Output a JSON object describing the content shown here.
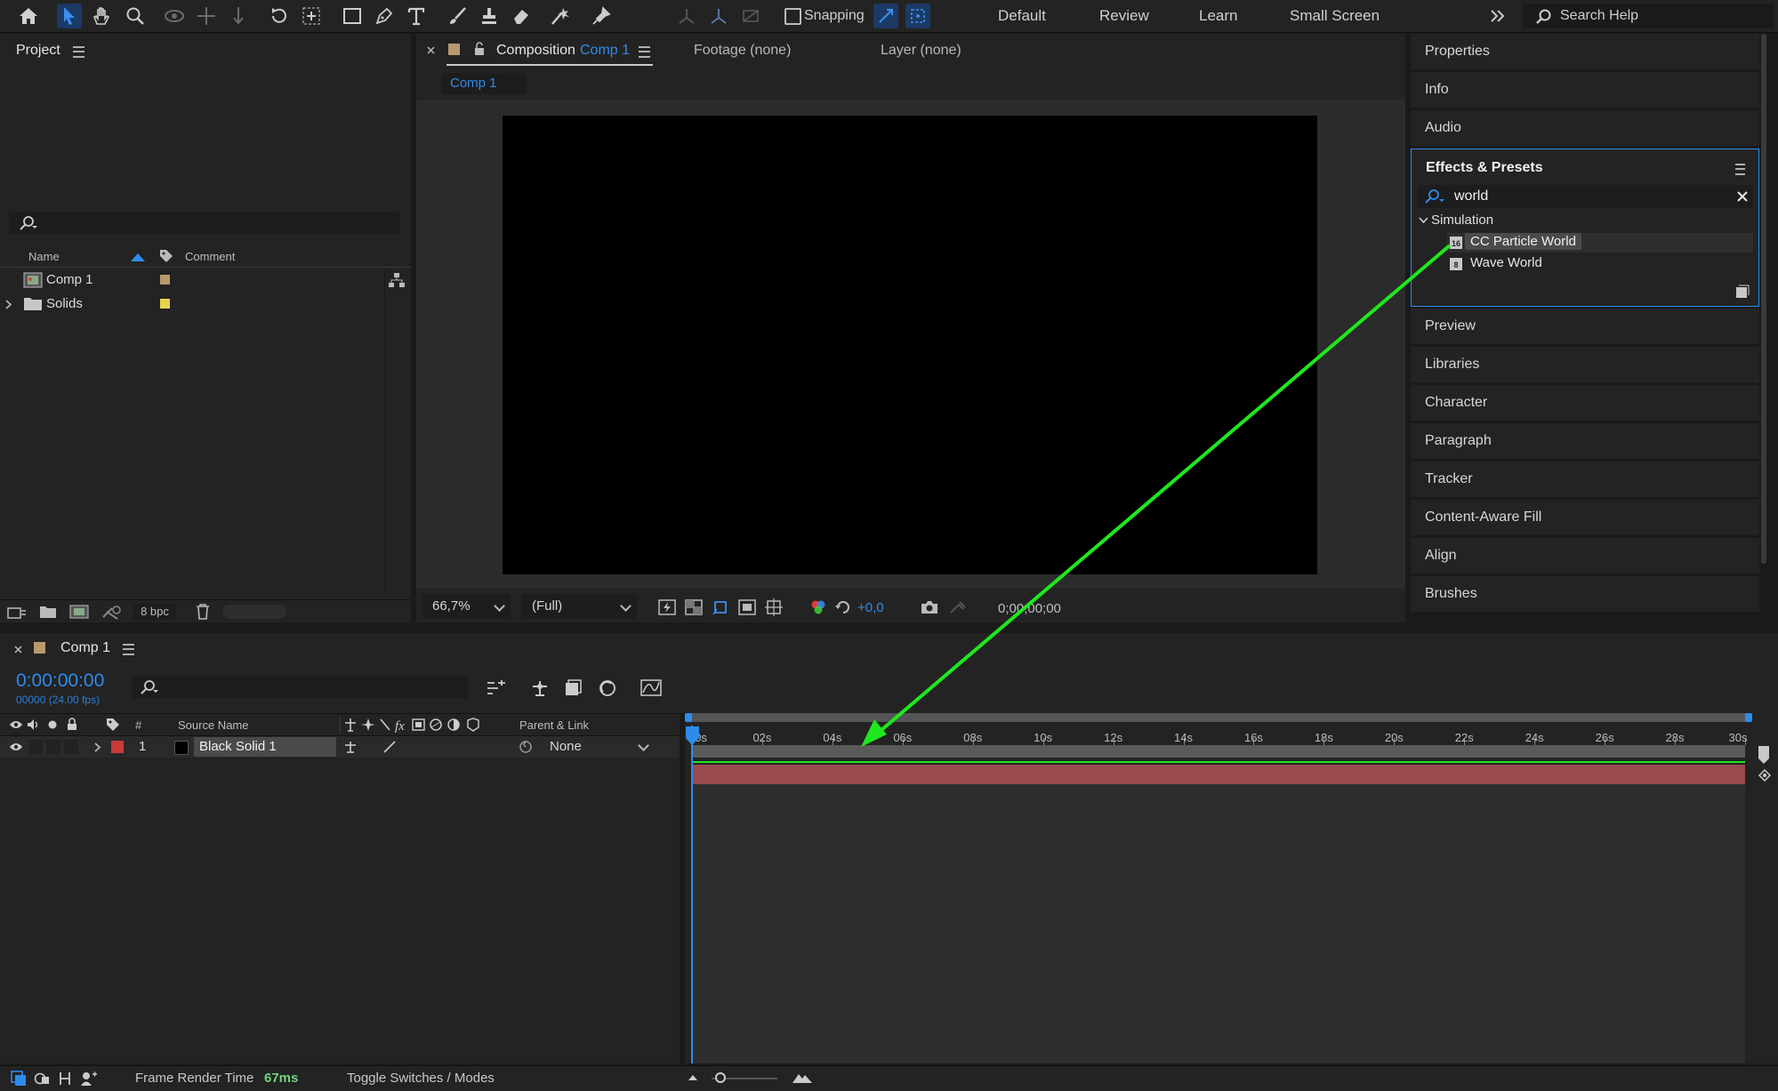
{
  "toolbar": {
    "snapping_label": "Snapping",
    "workspaces": [
      "Default",
      "Review",
      "Learn",
      "Small Screen"
    ],
    "search_help_placeholder": "Search Help"
  },
  "project": {
    "title": "Project",
    "columns": {
      "name": "Name",
      "comment": "Comment"
    },
    "items": [
      {
        "name": "Comp 1",
        "label_color": "#b89a6e"
      },
      {
        "name": "Solids",
        "label_color": "#e8d44d"
      }
    ],
    "bpc": "8 bpc"
  },
  "viewer": {
    "tab_composition": "Composition",
    "tab_composition_name": "Comp 1",
    "tab_footage": "Footage (none)",
    "tab_layer": "Layer (none)",
    "subtab": "Comp 1",
    "zoom": "66,7%",
    "resolution": "(Full)",
    "exposure": "+0,0",
    "timecode": "0;00;00;00"
  },
  "right_panels": {
    "top": [
      "Properties",
      "Info",
      "Audio"
    ],
    "effects": {
      "title": "Effects & Presets",
      "search_value": "world",
      "category": "Simulation",
      "items": [
        "CC Particle World",
        "Wave World"
      ]
    },
    "bottom": [
      "Preview",
      "Libraries",
      "Character",
      "Paragraph",
      "Tracker",
      "Content-Aware Fill",
      "Align",
      "Brushes"
    ]
  },
  "timeline": {
    "tab": "Comp 1",
    "current_time": "0:00:00:00",
    "frame_info": "00000 (24.00 fps)",
    "columns": {
      "num": "#",
      "source": "Source Name",
      "parent": "Parent & Link"
    },
    "ruler": [
      "0s",
      "02s",
      "04s",
      "06s",
      "08s",
      "10s",
      "12s",
      "14s",
      "16s",
      "18s",
      "20s",
      "22s",
      "24s",
      "26s",
      "28s",
      "30s"
    ],
    "layer": {
      "index": "1",
      "name": "Black Solid 1",
      "parent": "None",
      "label_color": "#c93a3a"
    }
  },
  "status": {
    "frame_render_label": "Frame Render Time",
    "frame_render_value": "67ms",
    "toggle_label": "Toggle Switches / Modes"
  },
  "colors": {
    "accent": "#2d8ceb",
    "annotation_arrow": "#1ee81e",
    "layer_bar": "#9a4a4e"
  }
}
